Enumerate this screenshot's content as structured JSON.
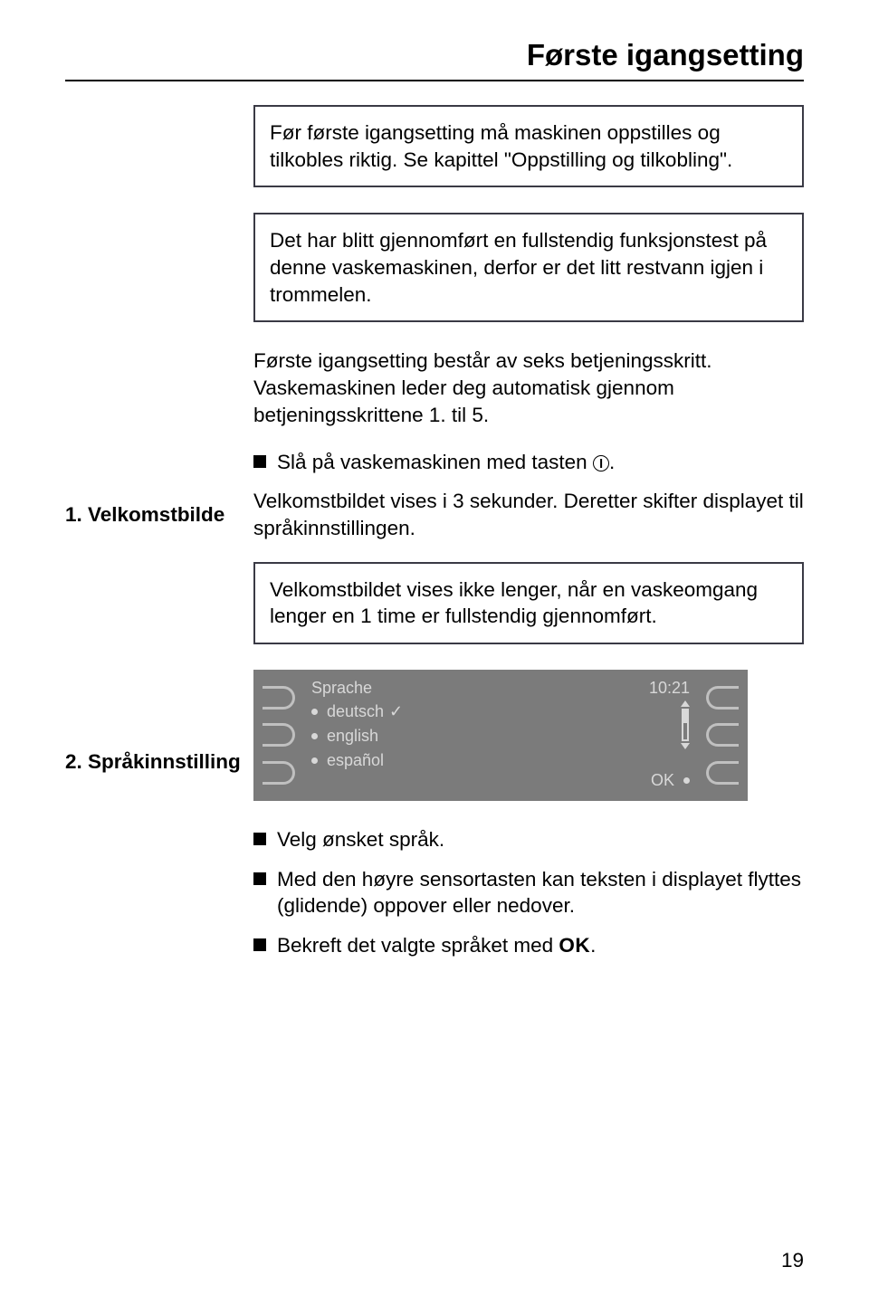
{
  "title": "Første igangsetting",
  "box1": "Før første igangsetting må maskinen oppstilles og tilkobles riktig. Se kapittel \"Oppstilling og tilkobling\".",
  "box2": "Det har blitt gjennomført en fullstendig funksjonstest på denne vaskemaskinen, derfor er det litt restvann igjen i trommelen.",
  "intro": "Første igangsetting består av seks betjeningsskritt. Vaskemaskinen leder deg automatisk gjennom betjeningsskrittene 1. til 5.",
  "side1": "1. Velkomstbilde",
  "bullet1": "Slå på vaskemaskinen med tasten ",
  "after_icon": ".",
  "para2": "Velkomstbildet vises i 3 sekunder. Deretter skifter displayet til språkinnstillingen.",
  "box3": "Velkomstbildet vises ikke lenger, når en vaskeomgang lenger en 1 time er fullstendig gjennomført.",
  "side2": "2. Språkinnstilling",
  "display": {
    "header": "Sprache",
    "time": "10:21",
    "items": [
      "deutsch",
      "english",
      "español"
    ],
    "selected_index": 0,
    "ok": "OK"
  },
  "bullet2": "Velg ønsket språk.",
  "bullet3": "Med den høyre sensortasten kan teksten i displayet flyttes (glidende) oppover eller nedover.",
  "bullet4_pre": "Bekreft det valgte språket med ",
  "bullet4_ok": "OK",
  "bullet4_post": ".",
  "page_number": "19"
}
